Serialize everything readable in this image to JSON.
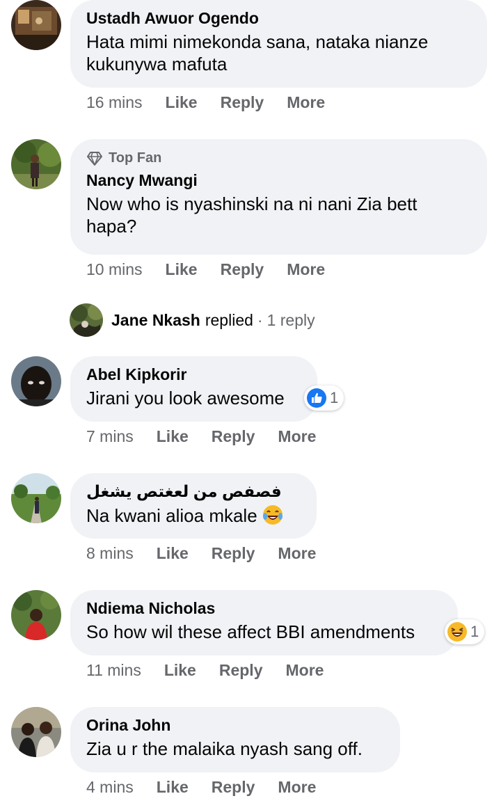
{
  "comments": [
    {
      "name": "Ustadh Awuor Ogendo",
      "text": "Hata mimi nimekonda sana, nataka nianze kukunywa mafuta",
      "time": "16 mins",
      "like": "Like",
      "reply": "Reply",
      "more": "More"
    },
    {
      "badge": "Top Fan",
      "name": "Nancy Mwangi",
      "text": "Now who is nyashinski na ni nani Zia bett hapa?",
      "time": "10 mins",
      "like": "Like",
      "reply": "Reply",
      "more": "More"
    },
    {
      "name": "Abel Kipkorir",
      "text": "Jirani you look awesome",
      "reaction_icon": "like-reaction-icon",
      "reaction_count": "1",
      "time": "7 mins",
      "like": "Like",
      "reply": "Reply",
      "more": "More"
    },
    {
      "name": "فصفص من لعغتص يشغل",
      "text": "Na kwani alioa mkale",
      "inline_emoji": "laughing-tears-emoji",
      "time": "8 mins",
      "like": "Like",
      "reply": "Reply",
      "more": "More"
    },
    {
      "name": "Ndiema Nicholas",
      "text": "So how wil these affect BBI amendments",
      "reaction_icon": "haha-reaction-icon",
      "reaction_count": "1",
      "time": "11 mins",
      "like": "Like",
      "reply": "Reply",
      "more": "More"
    },
    {
      "name": "Orina John",
      "text": "Zia u r the malaika nyash sang off.",
      "time": "4 mins",
      "like": "Like",
      "reply": "Reply",
      "more": "More"
    }
  ],
  "reply_summary": {
    "name": "Jane Nkash",
    "action": "replied",
    "separator": "·",
    "count": "1 reply"
  },
  "colors": {
    "bubble": "#f0f2f5",
    "meta_text": "#65676b",
    "like_blue": "#1877f2",
    "haha_yellow": "#f7b928"
  }
}
